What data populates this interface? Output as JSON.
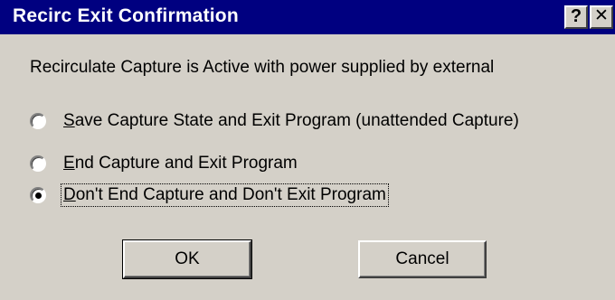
{
  "window": {
    "title": "Recirc Exit Confirmation",
    "help_label": "?",
    "close_label": "✕"
  },
  "message": "Recirculate Capture is Active with power supplied by external",
  "options": [
    {
      "mnemonic": "S",
      "rest": "ave Capture State and Exit Program (unattended Capture)",
      "selected": false
    },
    {
      "mnemonic": "E",
      "rest": "nd Capture and Exit Program",
      "selected": false
    },
    {
      "mnemonic": "D",
      "rest": "on't End Capture and Don't Exit Program",
      "selected": true
    }
  ],
  "buttons": {
    "ok_label": "OK",
    "cancel_label": "Cancel"
  },
  "colors": {
    "titlebar": "#000080",
    "face": "#d4d0c8"
  }
}
